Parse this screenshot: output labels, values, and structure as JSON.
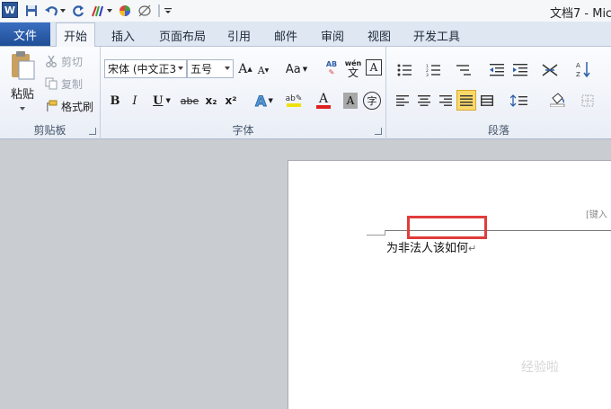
{
  "title_bar": {
    "app_logo": "W",
    "doc_title": "文档7 - Mic"
  },
  "tabs": {
    "file": "文件",
    "items": [
      "开始",
      "插入",
      "页面布局",
      "引用",
      "邮件",
      "审阅",
      "视图",
      "开发工具"
    ],
    "active": "开始"
  },
  "clipboard": {
    "paste": "粘贴",
    "cut": "剪切",
    "copy": "复制",
    "format_painter": "格式刷",
    "label": "剪贴板"
  },
  "font": {
    "font_name": "宋体 (中文正3",
    "font_size": "五号",
    "grow": "A",
    "shrink": "A",
    "change_case": "Aa",
    "label": "字体",
    "bold": "B",
    "italic": "I",
    "underline": "U",
    "strike": "abe",
    "subscript": "x₂",
    "superscript": "x²",
    "font_color_letter": "A",
    "char_shading": "A",
    "enclose": "字",
    "phonetic": "wén",
    "phonetic_char": "文",
    "border_char": "A"
  },
  "paragraph": {
    "label": "段落"
  },
  "document": {
    "header_hint": "[键入",
    "body_text": "为非法人该如何",
    "para_mark": "↵",
    "watermark": "经验啦"
  },
  "colors": {
    "highlight_box": "#e23b3b",
    "file_tab": "#2a5aa6",
    "font_color_bar": "#e02020",
    "highlight_bar": "#f0e010"
  }
}
